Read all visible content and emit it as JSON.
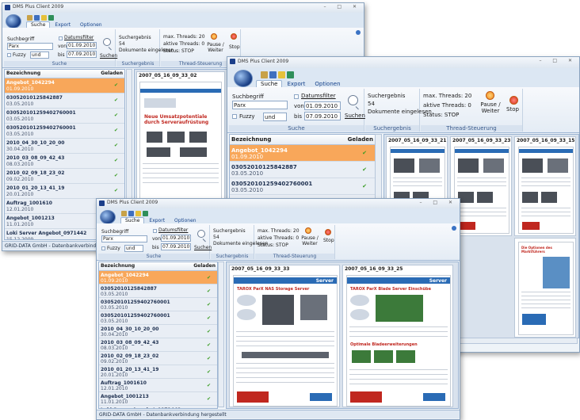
{
  "app": {
    "title": "DMS Plus Client 2009",
    "window_controls": "– □ ✕"
  },
  "ribbon": {
    "tabs": [
      "Suche",
      "Export",
      "Optionen"
    ],
    "suchbegriff_label": "Suchbegriff",
    "suchbegriff_value": "Parx",
    "fuzzy_label": "Fuzzy",
    "operator_value": "und",
    "datumsfilter_label": "Datumsfilter",
    "von_label": "von",
    "von_value": "01.09.2010",
    "bis_label": "bis",
    "bis_value": "07.09.2010",
    "suchen_label": "Suchen",
    "suchergebnis_label": "Suchergebnis",
    "suchergebnis_count": "54",
    "dokumente_eingelesen": "Dokumente eingelesen",
    "max_threads": "max. Threads: 20",
    "aktive_threads": "aktive Threads: 0",
    "status": "Status: STOP",
    "pause_label": "Pause / Weiter",
    "stop_label": "Stop",
    "group_suche": "Suche",
    "group_suchergebnis": "Suchergebnis",
    "group_thread": "Thread-Steuerung"
  },
  "list": {
    "col_name": "Bezeichnung",
    "col_geladen": "Geladen",
    "items": [
      {
        "name": "Angebot_1042294",
        "date": "01.09.2010"
      },
      {
        "name": "030520101258428​87",
        "date": "03.05.2010"
      },
      {
        "name": "030520101259402760001",
        "date": "03.05.2010"
      },
      {
        "name": "030520101259402760001",
        "date": "03.05.2010"
      },
      {
        "name": "2010_04_30_10_20_00",
        "date": "30.04.2010"
      },
      {
        "name": "2010_03_08_09_42_43",
        "date": "08.03.2010"
      },
      {
        "name": "2010_02_09_18_23_02",
        "date": "09.02.2010"
      },
      {
        "name": "2010_01_20_13_41_19",
        "date": "20.01.2010"
      },
      {
        "name": "Auftrag_1001610",
        "date": "12.01.2010"
      },
      {
        "name": "Angebot_1001213",
        "date": "11.01.2010"
      },
      {
        "name": "Loki Server Angebot_0971442",
        "date": "15.12.2009"
      }
    ]
  },
  "status_text": "GRID-DATA GmbH - Datenbankverbindung hergestellt",
  "thumbs": {
    "back": [
      "2007_05_16_09_33_02"
    ],
    "mid": [
      "2007_05_16_09_33_21",
      "2007_05_16_09_33_23",
      "2007_05_16_09_33_15",
      "2007_05_16_09_33_25"
    ],
    "front": [
      "2007_05_16_09_33_33",
      "2007_05_16_09_33_25"
    ]
  },
  "doc_text": {
    "back_headline": "Neue Umsatzpotentiale durch Serveraufrüstung",
    "front_a_title": "TAROX ParX NAS Storage Server",
    "front_b_title": "TAROX ParX Blade Server Einschübe",
    "front_b_sub": "Optimale Bladeerweiterungen",
    "front_tag": "Server",
    "mid_c_title": "Die Optionen des Marktführers"
  },
  "colors": {
    "selected": "#f8a75a",
    "accent": "#20468c",
    "check": "#3a9c24"
  }
}
